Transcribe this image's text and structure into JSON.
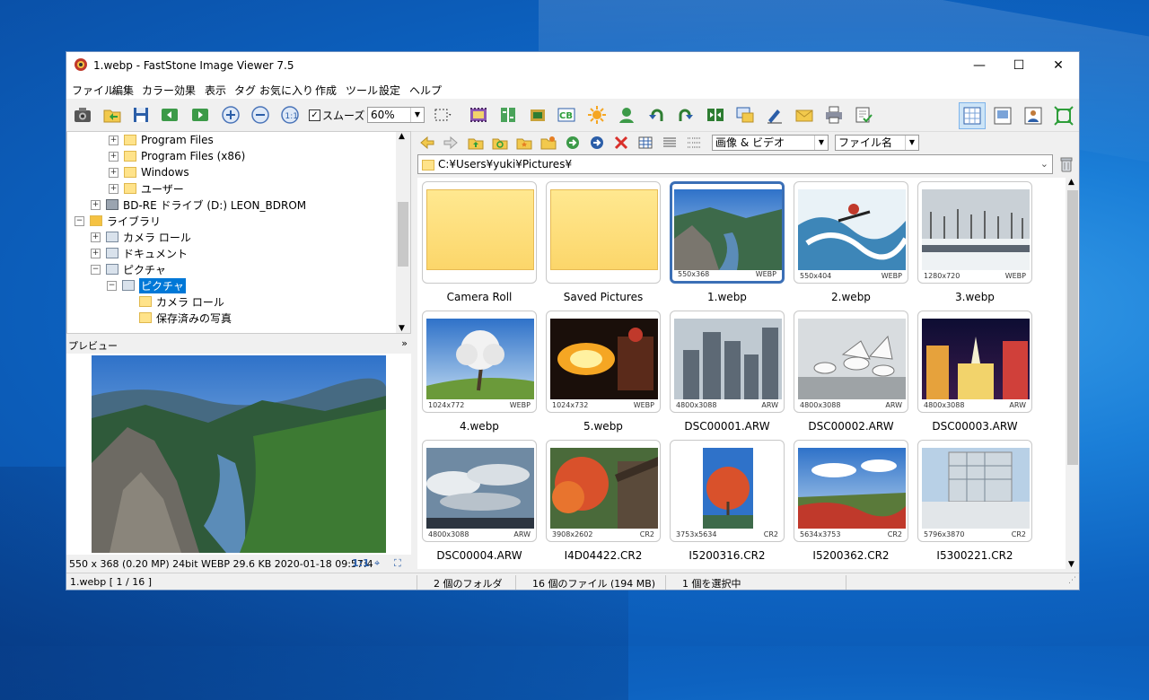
{
  "window": {
    "title": "1.webp  -  FastStone Image Viewer 7.5",
    "controls": [
      "—",
      "☐",
      "✕"
    ]
  },
  "menu": [
    "ファイル",
    "編集",
    "カラー",
    "効果",
    "表示",
    "タグ",
    "お気に入り",
    "作成",
    "ツール",
    "設定",
    "ヘルプ"
  ],
  "toolbar": {
    "smooth_label": "スムーズ",
    "smooth_checked": "✓",
    "zoom": "60%"
  },
  "tree": {
    "items": [
      {
        "label": "Program Files"
      },
      {
        "label": "Program Files (x86)"
      },
      {
        "label": "Windows"
      },
      {
        "label": "ユーザー"
      },
      {
        "label": "BD-RE ドライブ (D:) LEON_BDROM"
      },
      {
        "label": "ライブラリ"
      },
      {
        "label": "カメラ ロール"
      },
      {
        "label": "ドキュメント"
      },
      {
        "label": "ピクチャ"
      },
      {
        "label": "ピクチャ"
      },
      {
        "label": "カメラ ロール"
      },
      {
        "label": "保存済みの写真"
      }
    ]
  },
  "preview": {
    "header": "プレビュー",
    "info": "550 x 368 (0.20 MP)   24bit   WEBP    29.6 KB    2020-01-18 09:57:4",
    "actual_size": "1:1"
  },
  "nav": {
    "filter": "画像 & ビデオ",
    "sort": "ファイル名"
  },
  "address": "C:¥Users¥yuki¥Pictures¥",
  "thumbnails": [
    {
      "name": "Camera Roll",
      "dim": "",
      "ext": "",
      "kind": "folder"
    },
    {
      "name": "Saved Pictures",
      "dim": "",
      "ext": "",
      "kind": "folder"
    },
    {
      "name": "1.webp",
      "dim": "550x368",
      "ext": "WEBP",
      "kind": "valley"
    },
    {
      "name": "2.webp",
      "dim": "550x404",
      "ext": "WEBP",
      "kind": "kayak"
    },
    {
      "name": "3.webp",
      "dim": "1280x720",
      "ext": "WEBP",
      "kind": "snow"
    },
    {
      "name": "4.webp",
      "dim": "1024x772",
      "ext": "WEBP",
      "kind": "tree"
    },
    {
      "name": "5.webp",
      "dim": "1024x732",
      "ext": "WEBP",
      "kind": "fire"
    },
    {
      "name": "DSC00001.ARW",
      "dim": "4800x3088",
      "ext": "ARW",
      "kind": "towers"
    },
    {
      "name": "DSC00002.ARW",
      "dim": "4800x3088",
      "ext": "ARW",
      "kind": "gulls"
    },
    {
      "name": "DSC00003.ARW",
      "dim": "4800x3088",
      "ext": "ARW",
      "kind": "night"
    },
    {
      "name": "DSC00004.ARW",
      "dim": "4800x3088",
      "ext": "ARW",
      "kind": "clouds"
    },
    {
      "name": "I4D04422.CR2",
      "dim": "3908x2602",
      "ext": "CR2",
      "kind": "maple"
    },
    {
      "name": "I5200316.CR2",
      "dim": "3753x5634",
      "ext": "CR2",
      "kind": "redtree"
    },
    {
      "name": "I5200362.CR2",
      "dim": "5634x3753",
      "ext": "CR2",
      "kind": "field"
    },
    {
      "name": "I5300221.CR2",
      "dim": "5796x3870",
      "ext": "CR2",
      "kind": "building"
    }
  ],
  "status": {
    "file": "1.webp [ 1 / 16 ]",
    "folders": "2 個のフォルダ",
    "files": "16 個のファイル (194 MB)",
    "selected": "1 個を選択中"
  }
}
